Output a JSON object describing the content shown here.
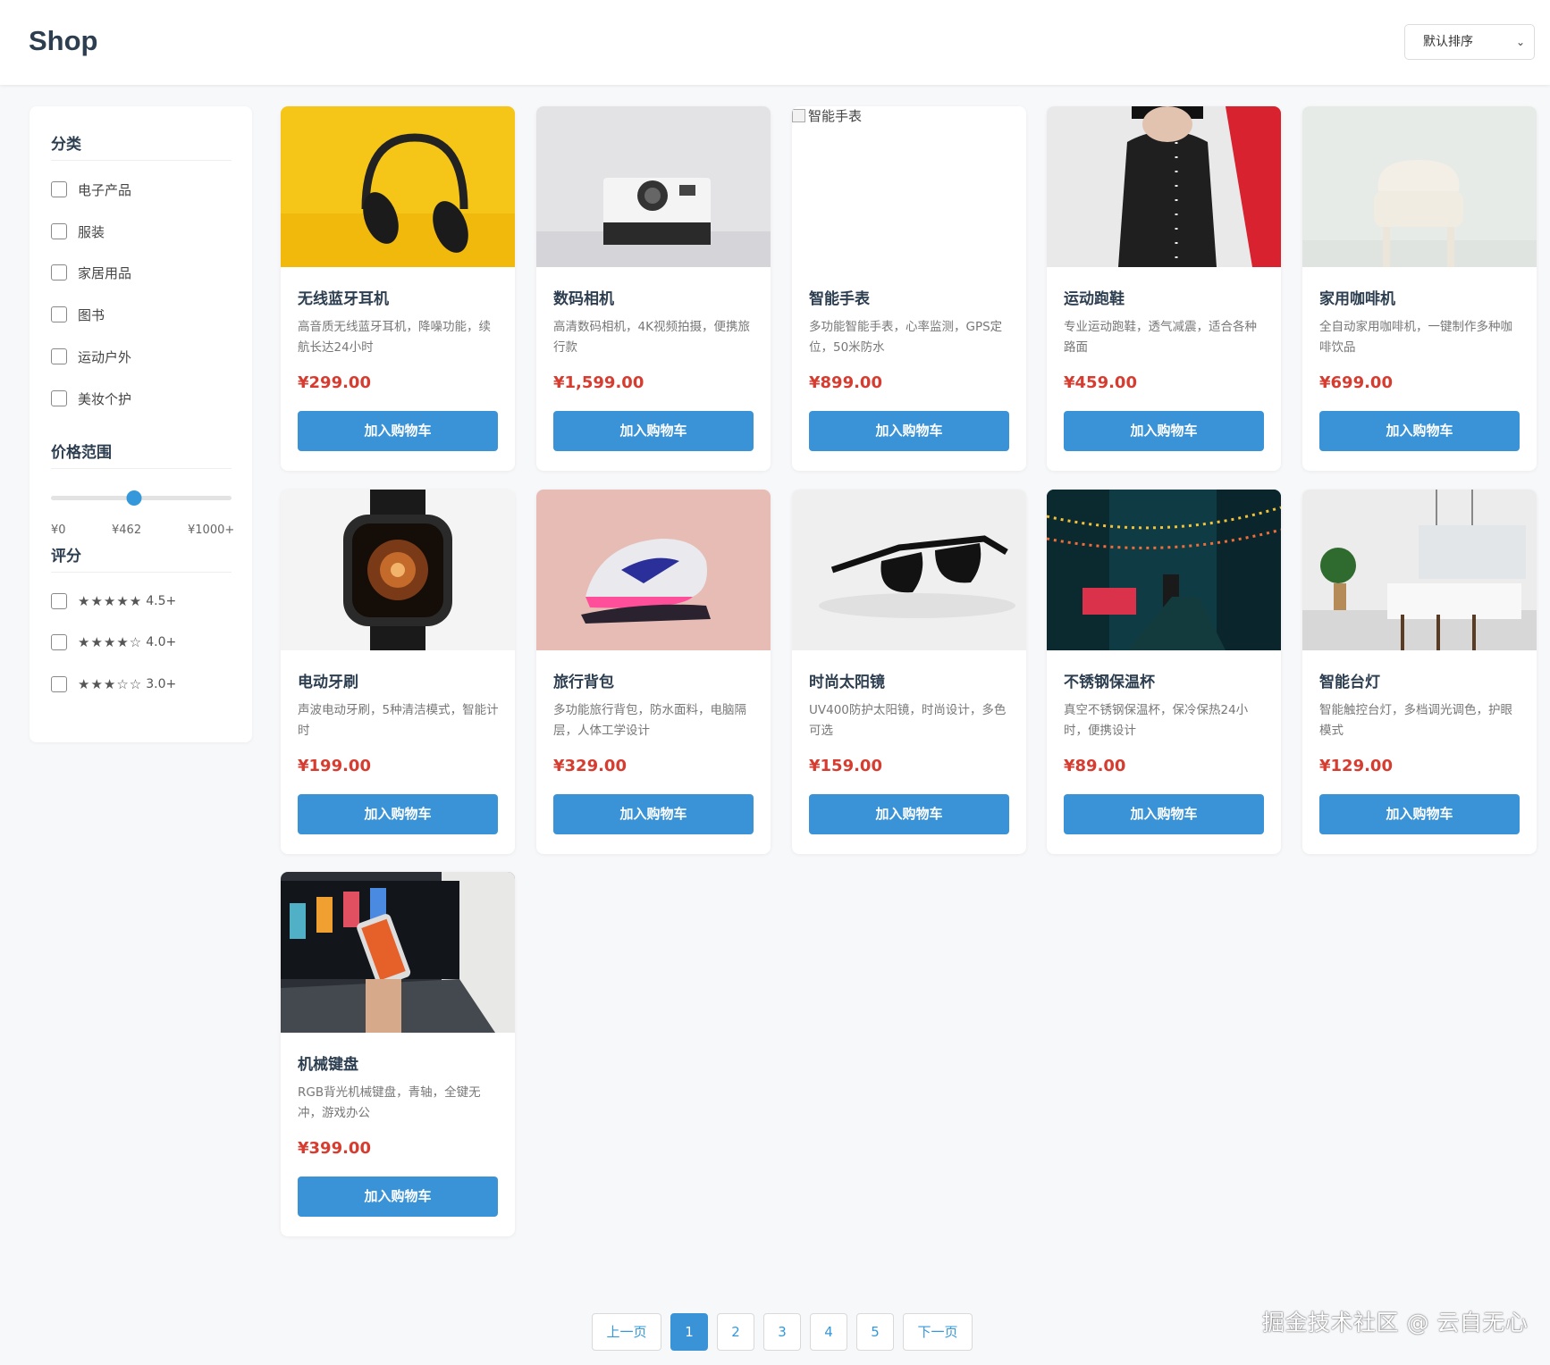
{
  "header": {
    "logo": "Shop",
    "sort": {
      "selected": "默认排序"
    }
  },
  "sidebar": {
    "category_title": "分类",
    "categories": [
      "电子产品",
      "服装",
      "家居用品",
      "图书",
      "运动户外",
      "美妆个护"
    ],
    "price_title": "价格范围",
    "price": {
      "min_label": "¥0",
      "current_label": "¥462",
      "max_label": "¥1000+",
      "min": 0,
      "max": 1000,
      "value": 462
    },
    "rating_title": "评分",
    "ratings": [
      {
        "stars": "★★★★★",
        "label": "4.5+"
      },
      {
        "stars": "★★★★☆",
        "label": "4.0+"
      },
      {
        "stars": "★★★☆☆",
        "label": "3.0+"
      }
    ]
  },
  "products": [
    {
      "name": "无线蓝牙耳机",
      "desc": "高音质无线蓝牙耳机，降噪功能，续航长达24小时",
      "price": "¥299.00",
      "button": "加入购物车",
      "image": "headphones-photo",
      "bg": "#f5c518"
    },
    {
      "name": "数码相机",
      "desc": "高清数码相机，4K视频拍摄，便携旅行款",
      "price": "¥1,599.00",
      "button": "加入购物车",
      "image": "camera-photo",
      "bg": "#e3e3e6"
    },
    {
      "name": "智能手表",
      "desc": "多功能智能手表，心率监测，GPS定位，50米防水",
      "price": "¥899.00",
      "button": "加入购物车",
      "image": "broken",
      "alt": "智能手表"
    },
    {
      "name": "运动跑鞋",
      "desc": "专业运动跑鞋，透气减震，适合各种路面",
      "price": "¥459.00",
      "button": "加入购物车",
      "image": "coat-photo",
      "bg": "#e9e9ea"
    },
    {
      "name": "家用咖啡机",
      "desc": "全自动家用咖啡机，一键制作多种咖啡饮品",
      "price": "¥699.00",
      "button": "加入购物车",
      "image": "chair-photo",
      "bg": "#e6ebe8"
    },
    {
      "name": "电动牙刷",
      "desc": "声波电动牙刷，5种清洁模式，智能计时",
      "price": "¥199.00",
      "button": "加入购物车",
      "image": "watch-photo",
      "bg": "#f4f4f4"
    },
    {
      "name": "旅行背包",
      "desc": "多功能旅行背包，防水面料，电脑隔层，人体工学设计",
      "price": "¥329.00",
      "button": "加入购物车",
      "image": "sneaker-photo",
      "bg": "#e6bcb4"
    },
    {
      "name": "时尚太阳镜",
      "desc": "UV400防护太阳镜，时尚设计，多色可选",
      "price": "¥159.00",
      "button": "加入购物车",
      "image": "sunglasses-photo",
      "bg": "#eeeeee"
    },
    {
      "name": "不锈钢保温杯",
      "desc": "真空不锈钢保温杯，保冷保热24小时，便携设计",
      "price": "¥89.00",
      "button": "加入购物车",
      "image": "street-photo",
      "bg": "#0f3c44"
    },
    {
      "name": "智能台灯",
      "desc": "智能触控台灯，多档调光调色，护眼模式",
      "price": "¥129.00",
      "button": "加入购物车",
      "image": "kitchen-photo",
      "bg": "#ececec"
    },
    {
      "name": "机械键盘",
      "desc": "RGB背光机械键盘，青轴，全键无冲，游戏办公",
      "price": "¥399.00",
      "button": "加入购物车",
      "image": "laptop-photo",
      "bg": "#2c3036"
    }
  ],
  "pagination": {
    "prev": "上一页",
    "pages": [
      "1",
      "2",
      "3",
      "4",
      "5"
    ],
    "active": "1",
    "next": "下一页"
  },
  "watermark": "掘金技术社区 @ 云自无心",
  "colors": {
    "accent": "#3a93d7",
    "price": "#d63c2f",
    "title": "#2c3e50"
  }
}
